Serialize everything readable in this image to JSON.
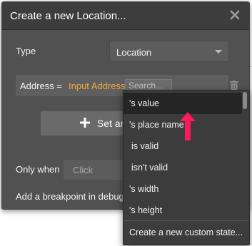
{
  "dialog": {
    "title": "Create a new Location...",
    "type_label": "Type",
    "type_value": "Location",
    "address": {
      "label": "Address =",
      "expression": "Input Address",
      "search_placeholder": "Search..."
    },
    "set_another_label": "Set another field",
    "only_when_label": "Only when",
    "only_when_placeholder": "Click",
    "breakpoint_label": "Add a breakpoint in debug mode"
  },
  "dropdown": {
    "items": [
      {
        "label": "'s value"
      },
      {
        "label": "'s place name"
      },
      {
        "label": "is valid"
      },
      {
        "label": "isn't valid"
      },
      {
        "label": "'s width"
      },
      {
        "label": "'s height"
      }
    ],
    "footer": "Create a new custom state..."
  },
  "colors": {
    "panel_bg": "#515151",
    "header_bg": "#3d3d3d",
    "expression": "#f4a640",
    "dropdown_bg": "#3c3c3c",
    "annotation_arrow": "#ff1a5c"
  },
  "icons": {
    "close": "close-icon",
    "trash": "trash-icon",
    "plus": "plus-icon",
    "caret": "chevron-down-icon"
  }
}
